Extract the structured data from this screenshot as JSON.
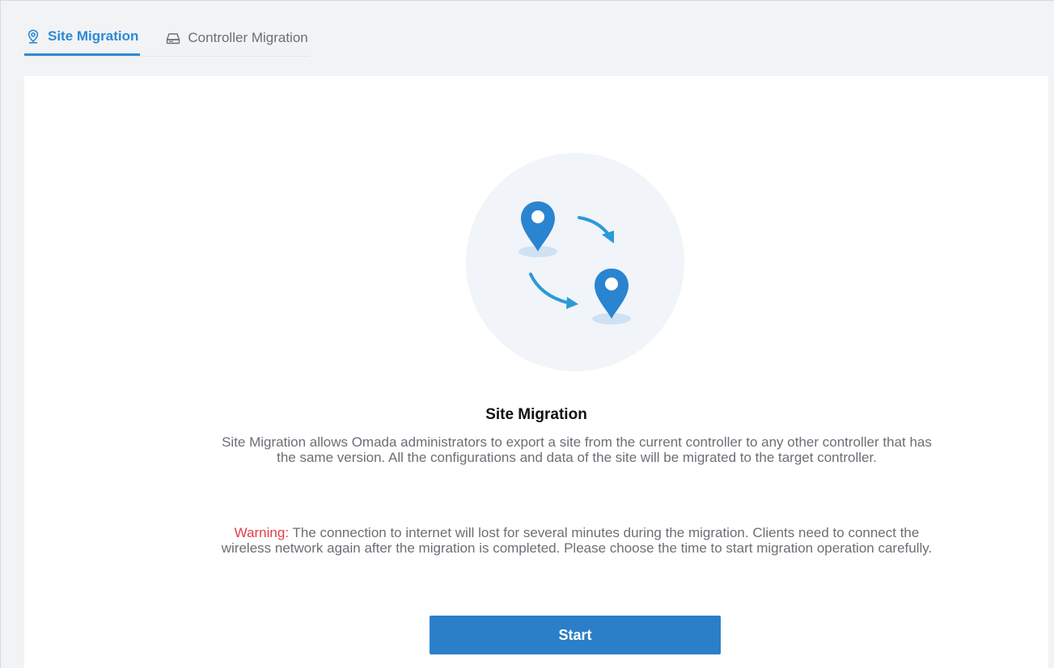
{
  "tabs": [
    {
      "label": "Site Migration",
      "icon": "location-pin-icon",
      "active": true
    },
    {
      "label": "Controller Migration",
      "icon": "controller-device-icon",
      "active": false
    }
  ],
  "main": {
    "title": "Site Migration",
    "description": "Site Migration allows Omada administrators to export a site from the current controller to any other controller that has the same version. All the configurations and data of the site will be migrated to the target controller.",
    "warning_label": "Warning:",
    "warning_text": " The connection to internet will lost for several minutes during the migration. Clients need to connect the wireless network again after the migration is completed. Please choose the time to start migration operation carefully.",
    "start_label": "Start"
  },
  "colors": {
    "accent": "#2b8ad6",
    "button": "#2b7fc8",
    "warning": "#e0404b",
    "page_bg": "#f2f3f5",
    "illustration_circle": "#f1f4f8"
  }
}
